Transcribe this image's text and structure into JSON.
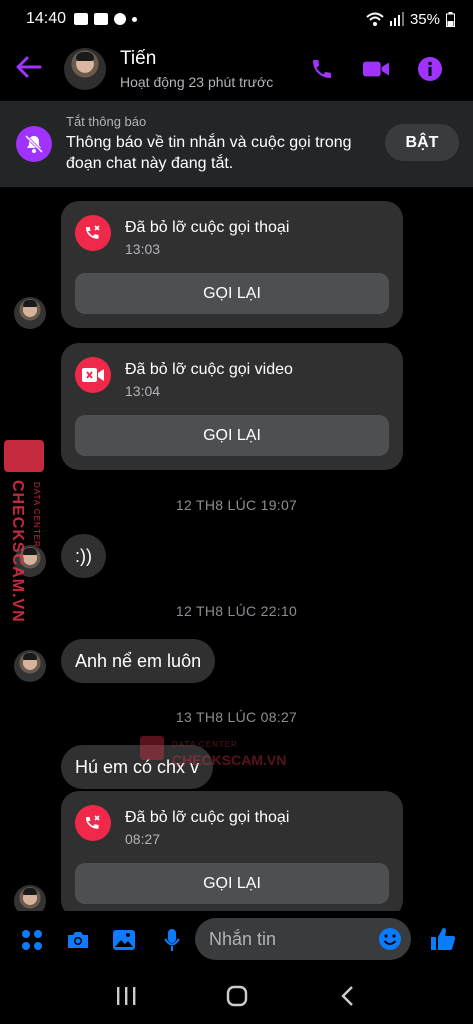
{
  "status_bar": {
    "time": "14:40",
    "battery": "35%"
  },
  "header": {
    "name": "Tiến",
    "status": "Hoạt động 23 phút trước"
  },
  "banner": {
    "title": "Tắt thông báo",
    "body": "Thông báo về tin nhắn và cuộc gọi trong đoạn chat này đang tắt.",
    "button": "BẬT"
  },
  "messages": {
    "call1": {
      "title": "Đã bỏ lỡ cuộc gọi thoại",
      "time": "13:03",
      "button": "GỌI LẠI"
    },
    "call2": {
      "title": "Đã bỏ lỡ cuộc gọi video",
      "time": "13:04",
      "button": "GỌI LẠI"
    },
    "ts1": "12 TH8 LÚC 19:07",
    "msg1": ":))",
    "ts2": "12 TH8 LÚC 22:10",
    "msg2": "Anh nể em luôn",
    "ts3": "13 TH8 LÚC 08:27",
    "msg3": "Hú em có chx v",
    "call3": {
      "title": "Đã bỏ lỡ cuộc gọi thoại",
      "time": "08:27",
      "button": "GỌI LẠI"
    }
  },
  "watermark": {
    "side_main": "CHECKSCAM.VN",
    "side_sub": "DATA CENTER",
    "center_sub": "DATA CENTER",
    "center_main": "CHECKSCAM.VN"
  },
  "composer": {
    "placeholder": "Nhắn tin"
  },
  "colors": {
    "accent": "#a033ff",
    "composer_icon": "#0a7cff",
    "missed_call": "#f02849",
    "watermark": "#e8314a"
  }
}
